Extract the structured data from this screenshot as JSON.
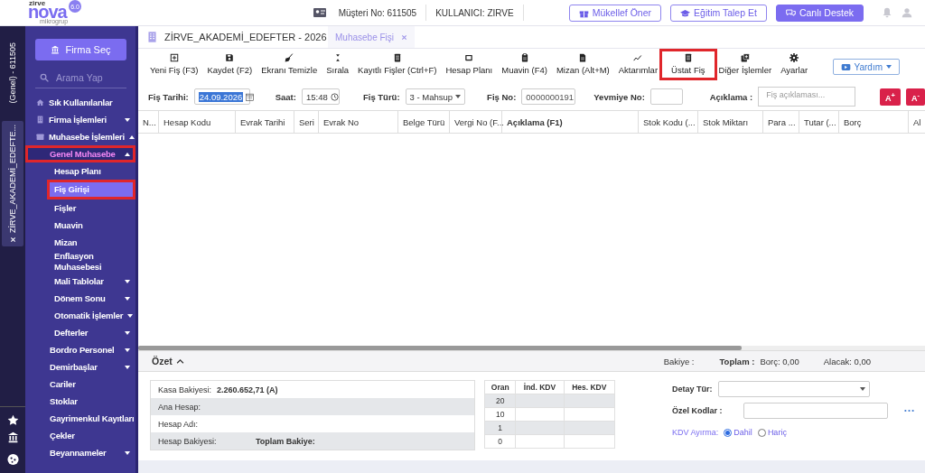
{
  "header": {
    "logo": {
      "small": "zirve",
      "name": "nova",
      "badge": "6.0",
      "sub": "mikrogrup"
    },
    "customer": "Müşteri No: 611505",
    "user": "KULLANICI: ZIRVE",
    "buttons": [
      {
        "label": "Mükellef Öner",
        "kind": "outline"
      },
      {
        "label": "Eğitim Talep Et",
        "kind": "outline"
      },
      {
        "label": "Canlı Destek",
        "kind": "filled"
      }
    ]
  },
  "strip": {
    "context": "(Genel) - 611505",
    "tab": "ZİRVE_AKADEMİ_EDEFTE..."
  },
  "sidebar": {
    "firm_button": "Firma Seç",
    "search": {
      "placeholder": "Arama Yap"
    },
    "items": [
      {
        "label": "Sık Kullanılanlar",
        "selected": false,
        "highlighted": false
      },
      {
        "label": "Firma İşlemleri",
        "expanded": false,
        "selected": false,
        "highlighted": false
      },
      {
        "label": "Muhasebe İşlemleri",
        "expanded": true,
        "selected": false,
        "highlighted": false,
        "children": [
          {
            "label": "Genel Muhasebe",
            "expanded": true,
            "selected": false,
            "highlighted": true,
            "children": [
              {
                "label": "Hesap Planı",
                "selected": false,
                "highlighted": false
              },
              {
                "label": "Fiş Girişi",
                "selected": true,
                "highlighted": true
              },
              {
                "label": "Fişler",
                "selected": false,
                "highlighted": false
              },
              {
                "label": "Muavin",
                "selected": false,
                "highlighted": false
              },
              {
                "label": "Mizan",
                "selected": false,
                "highlighted": false
              },
              {
                "label": "Enflasyon Muhasebesi",
                "selected": false,
                "highlighted": false
              },
              {
                "label": "Mali Tablolar",
                "expanded": false,
                "selected": false,
                "highlighted": false
              },
              {
                "label": "Dönem Sonu",
                "expanded": false,
                "selected": false,
                "highlighted": false
              },
              {
                "label": "Otomatik İşlemler",
                "expanded": false,
                "selected": false,
                "highlighted": false
              },
              {
                "label": "Defterler",
                "expanded": false,
                "selected": false,
                "highlighted": false
              }
            ]
          },
          {
            "label": "Bordro Personel",
            "expanded": false,
            "selected": false,
            "highlighted": false
          },
          {
            "label": "Demirbaşlar",
            "expanded": false,
            "selected": false,
            "highlighted": false
          },
          {
            "label": "Cariler",
            "selected": false,
            "highlighted": false
          },
          {
            "label": "Stoklar",
            "selected": false,
            "highlighted": false
          },
          {
            "label": "Gayrimenkul Kayıtları",
            "selected": false,
            "highlighted": false
          },
          {
            "label": "Çekler",
            "selected": false,
            "highlighted": false
          },
          {
            "label": "Beyannameler",
            "expanded": false,
            "selected": false,
            "highlighted": false
          }
        ]
      }
    ]
  },
  "workspace": {
    "title": "ZİRVE_AKADEMİ_EDEFTER - 2026",
    "tabs": [
      {
        "label": "Muhasebe Fişi",
        "selected": true
      }
    ]
  },
  "toolbar": {
    "items": [
      {
        "label": "Yeni Fiş (F3)",
        "highlighted": false
      },
      {
        "label": "Kaydet (F2)",
        "highlighted": false
      },
      {
        "label": "Ekranı Temizle",
        "highlighted": false
      },
      {
        "label": "Sırala",
        "highlighted": false
      },
      {
        "label": "Kayıtlı Fişler (Ctrl+F)",
        "highlighted": false
      },
      {
        "label": "Hesap Planı",
        "highlighted": false
      },
      {
        "label": "Muavin (F4)",
        "highlighted": false
      },
      {
        "label": "Mizan (Alt+M)",
        "highlighted": false
      },
      {
        "label": "Aktarımlar",
        "highlighted": false
      },
      {
        "label": "Üstat Fiş",
        "highlighted": true
      },
      {
        "label": "Diğer İşlemler",
        "highlighted": false
      },
      {
        "label": "Ayarlar",
        "highlighted": false
      }
    ],
    "help": "Yardım"
  },
  "form": {
    "date_label": "Fiş Tarihi:",
    "date": "24.09.2026",
    "time_label": "Saat:",
    "time": "15:48",
    "type_label": "Fiş Türü:",
    "type": "3 - Mahsup",
    "no_label": "Fiş No:",
    "no": "0000000191",
    "journal_label": "Yevmiye No:",
    "desc_label": "Açıklama :",
    "desc_placeholder": "Fiş açıklaması...",
    "font_buttons": [
      "A$^{+}$",
      "A$^{-}$"
    ]
  },
  "table": {
    "columns": [
      {
        "label": "N...",
        "emphasis": false
      },
      {
        "label": "Hesap Kodu",
        "emphasis": false
      },
      {
        "label": "Evrak Tarihi",
        "emphasis": false
      },
      {
        "label": "Seri",
        "emphasis": false
      },
      {
        "label": "Evrak No",
        "emphasis": false
      },
      {
        "label": "Belge Türü",
        "emphasis": false
      },
      {
        "label": "Vergi No (F...",
        "emphasis": false
      },
      {
        "label": "Açıklama (F1)",
        "emphasis": true
      },
      {
        "label": "Stok Kodu (...",
        "emphasis": false
      },
      {
        "label": "Stok Miktarı",
        "emphasis": false
      },
      {
        "label": "Para ...",
        "emphasis": false
      },
      {
        "label": "Tutar (...",
        "emphasis": false
      },
      {
        "label": "Borç",
        "emphasis": false
      },
      {
        "label": "Al",
        "emphasis": false
      }
    ]
  },
  "summary": {
    "title": "Özet",
    "expanded": true,
    "balance": "Bakiye :",
    "total": "Toplam :",
    "debit": "Borç: 0,00",
    "credit": "Alacak: 0,00",
    "info": [
      {
        "label": "Kasa Bakiyesi:",
        "value": "2.260.652,71 (A)"
      },
      {
        "label": "Ana Hesap:"
      },
      {
        "label": "Hesap Adı:"
      },
      {
        "label": "Hesap Bakiyesi:",
        "total_label": "Toplam Bakiye:"
      }
    ],
    "kdv": {
      "columns": [
        "Oran",
        "İnd. KDV",
        "Hes. KDV"
      ],
      "rows": [
        "20",
        "10",
        "1",
        "0"
      ]
    },
    "detail_label": "Detay Tür:",
    "codes_label": "Özel Kodlar :",
    "kdv_label": "KDV Ayırma:",
    "kdv_options": [
      {
        "label": "Dahil",
        "selected": true
      },
      {
        "label": "Hariç",
        "selected": false
      }
    ]
  }
}
